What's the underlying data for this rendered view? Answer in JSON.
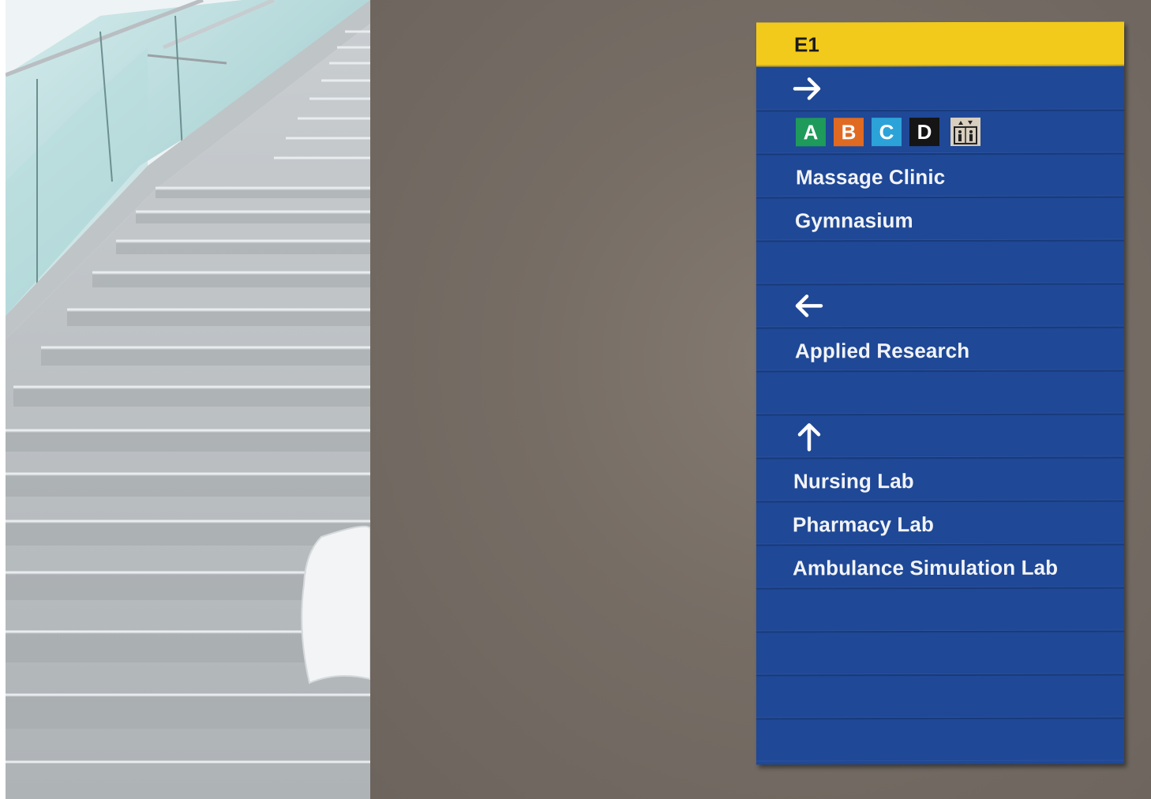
{
  "sign": {
    "header": "E1",
    "rows": [
      {
        "kind": "arrow",
        "icon": "arrow-right-icon"
      },
      {
        "kind": "buildings",
        "badges": [
          {
            "letter": "A",
            "color": "#1e9a5a"
          },
          {
            "letter": "B",
            "color": "#e06a22"
          },
          {
            "letter": "C",
            "color": "#2ba3d8"
          },
          {
            "letter": "D",
            "color": "#151515"
          }
        ],
        "extra_icon": "elevator-icon"
      },
      {
        "kind": "text",
        "text": "Massage Clinic"
      },
      {
        "kind": "text",
        "text": "Gymnasium"
      },
      {
        "kind": "blank"
      },
      {
        "kind": "arrow",
        "icon": "arrow-left-icon"
      },
      {
        "kind": "text",
        "text": "Applied Research"
      },
      {
        "kind": "blank"
      },
      {
        "kind": "arrow",
        "icon": "arrow-up-icon"
      },
      {
        "kind": "text",
        "text": "Nursing Lab"
      },
      {
        "kind": "text",
        "text": "Pharmacy Lab"
      },
      {
        "kind": "text",
        "text": "Ambulance Simulation Lab"
      },
      {
        "kind": "blank"
      },
      {
        "kind": "blank"
      },
      {
        "kind": "blank"
      },
      {
        "kind": "blank"
      }
    ]
  },
  "colors": {
    "sign_blue": "#1f4896",
    "header_yellow": "#f2ca1b",
    "wall": "#766d65"
  }
}
